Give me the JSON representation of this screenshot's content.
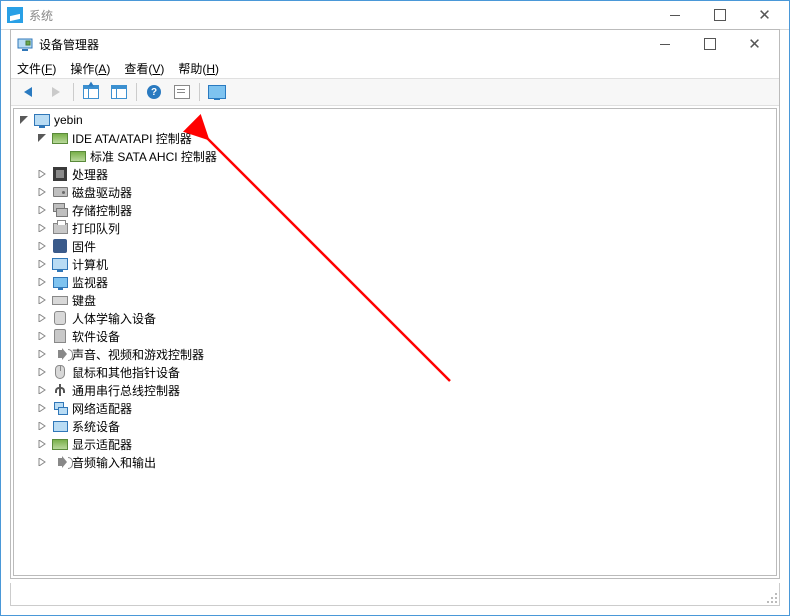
{
  "outer_window": {
    "title": "系统"
  },
  "inner_window": {
    "title": "设备管理器"
  },
  "menu": {
    "file": "文件(<u>F</u>)",
    "action": "操作(<u>A</u>)",
    "view": "查看(<u>V</u>)",
    "help": "帮助(<u>H</u>)"
  },
  "tree": {
    "root": "yebin",
    "ide": {
      "label": "IDE ATA/ATAPI 控制器",
      "child": "标准 SATA AHCI 控制器"
    },
    "items": [
      "处理器",
      "磁盘驱动器",
      "存储控制器",
      "打印队列",
      "固件",
      "计算机",
      "监视器",
      "键盘",
      "人体学输入设备",
      "软件设备",
      "声音、视频和游戏控制器",
      "鼠标和其他指针设备",
      "通用串行总线控制器",
      "网络适配器",
      "系统设备",
      "显示适配器",
      "音频输入和输出"
    ]
  }
}
